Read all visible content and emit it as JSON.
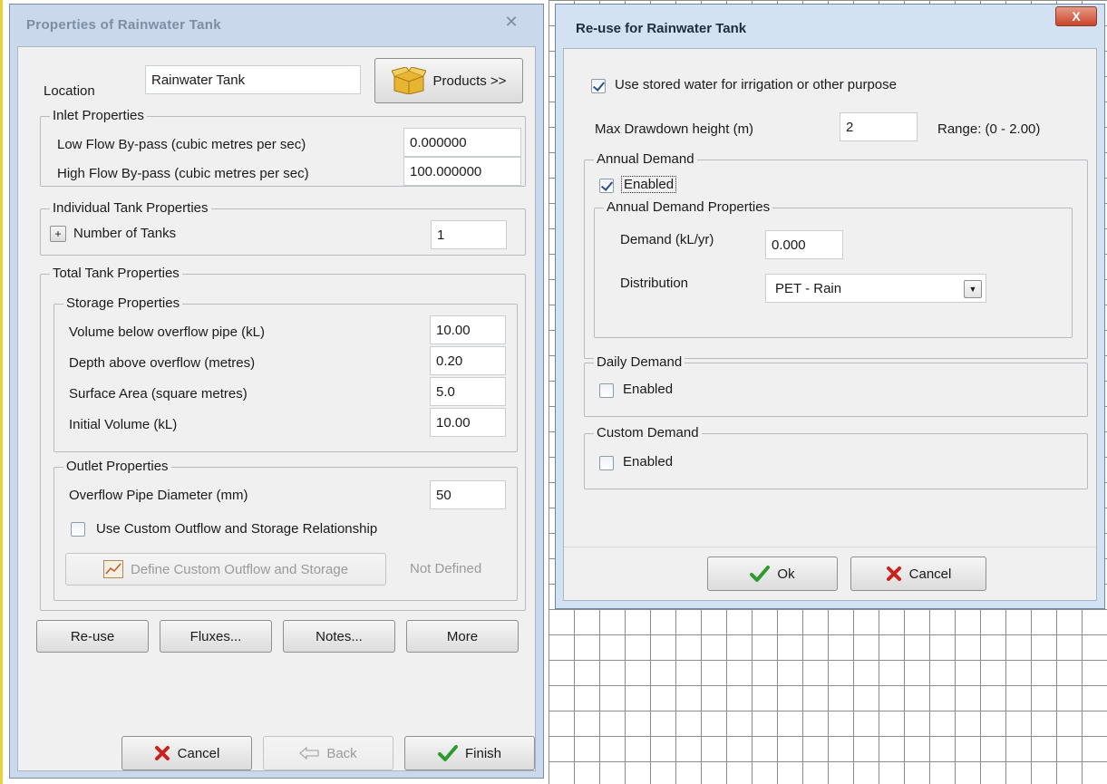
{
  "dialog_properties": {
    "title": "Properties of Rainwater Tank",
    "close_glyph": "✕",
    "location_label": "Location",
    "location_value": "Rainwater Tank",
    "products_button": "Products >>",
    "inlet": {
      "group_title": "Inlet Properties",
      "low_flow_label": "Low Flow By-pass (cubic metres per sec)",
      "low_flow_value": "0.000000",
      "high_flow_label": "High Flow By-pass (cubic metres per sec)",
      "high_flow_value": "100.000000"
    },
    "individual": {
      "group_title": "Individual Tank Properties",
      "expand_glyph": "+",
      "number_label": "Number of Tanks",
      "number_value": "1"
    },
    "total": {
      "group_title": "Total Tank Properties",
      "storage": {
        "group_title": "Storage Properties",
        "volume_label": "Volume below overflow pipe  (kL)",
        "volume_value": "10.00",
        "depth_label": "Depth above overflow (metres)",
        "depth_value": "0.20",
        "area_label": "Surface Area (square metres)",
        "area_value": "5.0",
        "initial_label": "Initial Volume (kL)",
        "initial_value": "10.00"
      },
      "outlet": {
        "group_title": "Outlet Properties",
        "diameter_label": "Overflow Pipe Diameter (mm)",
        "diameter_value": "50",
        "custom_checkbox_label": "Use Custom Outflow and Storage Relationship",
        "custom_checked": false,
        "define_button": "Define Custom Outflow and Storage",
        "not_defined": "Not Defined"
      }
    },
    "action_buttons": [
      "Re-use",
      "Fluxes...",
      "Notes...",
      "More"
    ],
    "footer": {
      "cancel": "Cancel",
      "back": "Back",
      "finish": "Finish"
    }
  },
  "dialog_reuse": {
    "title": "Re-use for Rainwater Tank",
    "close_glyph": "X",
    "use_stored_label": "Use stored water for irrigation or other purpose",
    "use_stored_checked": true,
    "drawdown_label": "Max Drawdown height (m)",
    "drawdown_value": "2",
    "range_text": "Range: (0 - 2.00)",
    "annual": {
      "group_title": "Annual Demand",
      "enabled_label": "Enabled",
      "enabled_checked": true,
      "props_title": "Annual Demand Properties",
      "demand_label": "Demand (kL/yr)",
      "demand_value": "0.000",
      "distribution_label": "Distribution",
      "distribution_value": "PET - Rain"
    },
    "daily": {
      "group_title": "Daily Demand",
      "enabled_label": "Enabled",
      "enabled_checked": false
    },
    "custom": {
      "group_title": "Custom Demand",
      "enabled_label": "Enabled",
      "enabled_checked": false
    },
    "ok": "Ok",
    "cancel": "Cancel"
  },
  "colors": {
    "check_green": "#2e9b2e",
    "cancel_red": "#c9231e",
    "close_red": "#c9442b"
  }
}
